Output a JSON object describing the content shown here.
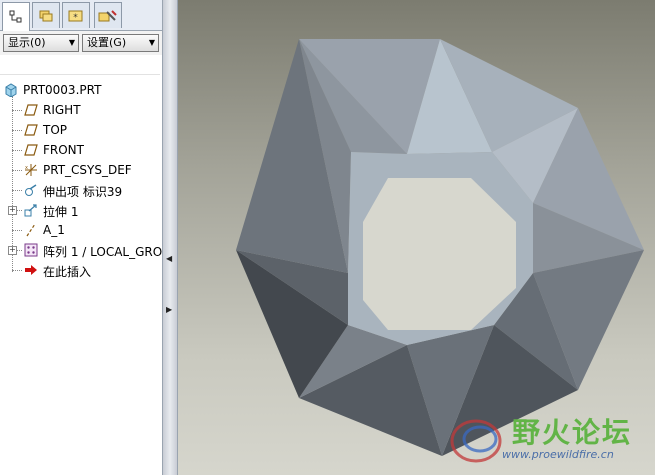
{
  "tabs": [
    {
      "name": "model-tree-tab",
      "icon": "tree-icon",
      "active": true
    },
    {
      "name": "folder-tab",
      "icon": "folder-icon",
      "active": false
    },
    {
      "name": "favorites-tab",
      "icon": "favorites-icon",
      "active": false
    },
    {
      "name": "tools-tab",
      "icon": "tools-icon",
      "active": false
    }
  ],
  "toolbar": {
    "show_label": "显示(0)",
    "settings_label": "设置(G)"
  },
  "tree": {
    "root": "PRT0003.PRT",
    "items": [
      {
        "label": "RIGHT",
        "icon": "datum-plane-icon"
      },
      {
        "label": "TOP",
        "icon": "datum-plane-icon"
      },
      {
        "label": "FRONT",
        "icon": "datum-plane-icon"
      },
      {
        "label": "PRT_CSYS_DEF",
        "icon": "coordinate-system-icon"
      },
      {
        "label": "伸出项 标识39",
        "icon": "protrusion-icon"
      },
      {
        "label": "拉伸 1",
        "icon": "extrude-icon"
      },
      {
        "label": "A_1",
        "icon": "axis-icon"
      },
      {
        "label": "阵列 1 / LOCAL_GRO",
        "icon": "pattern-icon"
      },
      {
        "label": "在此插入",
        "icon": "insert-here-icon"
      }
    ]
  },
  "watermark": {
    "title": "野火论坛",
    "url": "www.proewildfire.cn"
  },
  "colors": {
    "panel_bg": "#ffffff",
    "tab_bg": "#e6ebf3",
    "viewport_top": "#7c7c70",
    "viewport_bottom": "#d6d6cd",
    "insert_arrow": "#d01010",
    "watermark_green": "#62b447"
  }
}
